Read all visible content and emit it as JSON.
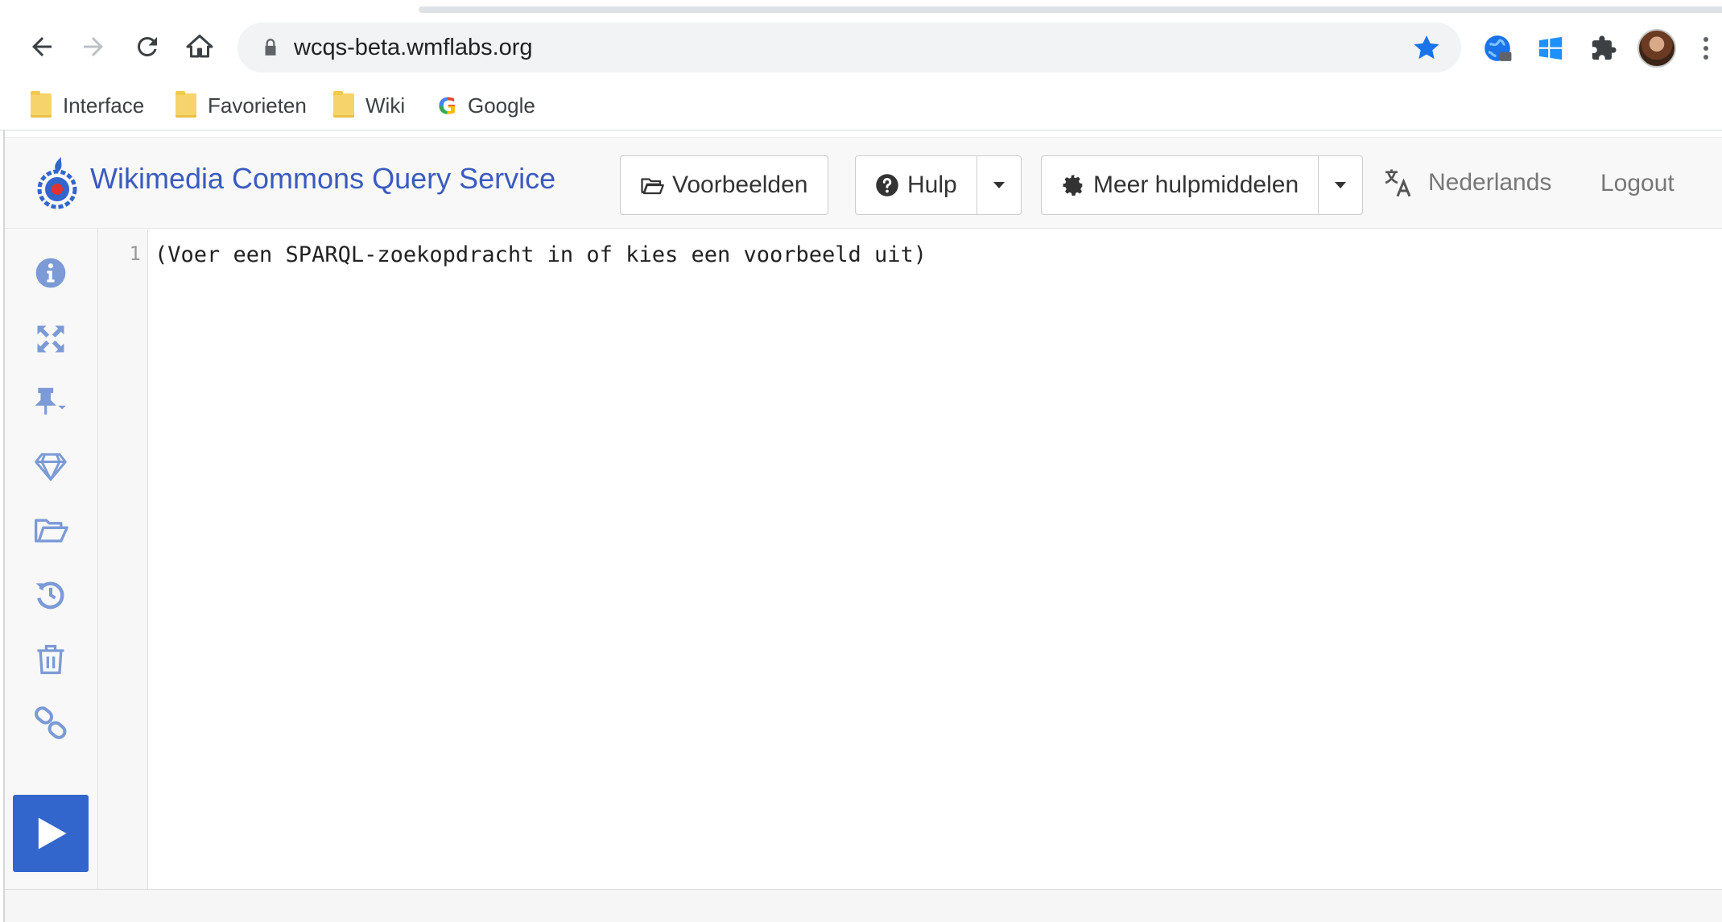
{
  "browser": {
    "url": "wcqs-beta.wmflabs.org",
    "bookmarks": [
      {
        "label": "Interface",
        "icon": "folder-icon"
      },
      {
        "label": "Favorieten",
        "icon": "folder-icon"
      },
      {
        "label": "Wiki",
        "icon": "folder-icon"
      },
      {
        "label": "Google",
        "icon": "google-icon"
      }
    ],
    "google_letter": "G"
  },
  "header": {
    "title": "Wikimedia Commons Query Service",
    "examples_label": "Voorbeelden",
    "help_label": "Hulp",
    "more_tools_label": "Meer hulpmiddelen",
    "language_label": "Nederlands",
    "logout_label": "Logout"
  },
  "sidebar": {
    "tools": [
      "info-icon",
      "fullscreen-icon",
      "pin-icon",
      "gem-icon",
      "folder-open-icon",
      "history-icon",
      "trash-icon",
      "link-icon"
    ],
    "run": "play-icon"
  },
  "editor": {
    "line_number": "1",
    "placeholder": "(Voer een SPARQL-zoekopdracht in of kies een voorbeeld uit)"
  },
  "colors": {
    "accent": "#3366cc",
    "title": "#3a5bbf",
    "icon": "#7b9ad6"
  }
}
